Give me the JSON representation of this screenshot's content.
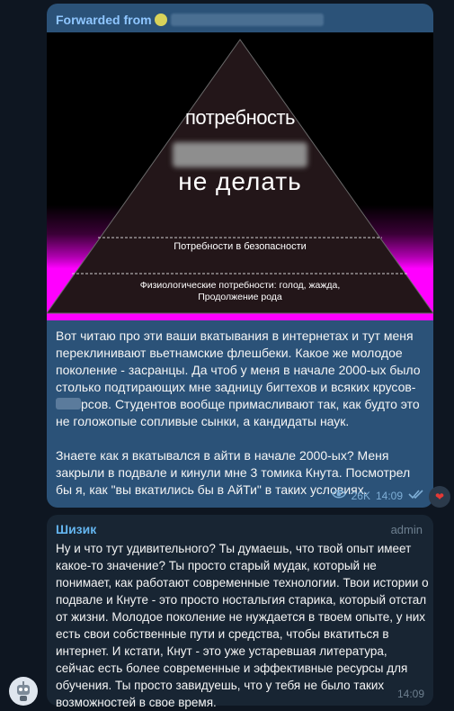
{
  "forward": {
    "label": "Forwarded from"
  },
  "meme": {
    "line1": "потребность",
    "line3": "не делать",
    "safety": "Потребности в безопасности",
    "physiological": "Физиологические потребности: голод, жажда, Продолжение рода"
  },
  "post": {
    "para1_a": "Вот читаю про эти ваши вкатывания в интернетах и тут меня переклинивают вьетнамские флешбеки. Какое же молодое поколение - засранцы. Да чтоб у меня в начале 2000-ых было столько подтирающих мне задницу бигтехов и всяких крусов-",
    "para1_b": "рсов. Студентов вообще примасливают так, как будто это не голожопые сопливые сынки, а кандидаты наук.",
    "para2": "Знаете как я вкатывался в айти в начале 2000-ых? Меня закрыли в подвале и кинули мне 3 томика Кнута. Посмотрел бы я, как \"вы вкатились бы в АйТи\" в таких условиях.",
    "views": "26K",
    "time": "14:09",
    "reaction": "❤"
  },
  "reply": {
    "author": "Шизик",
    "role": "admin",
    "text": "Ну и что тут удивительного? Ты думаешь, что твой опыт имеет какое-то значение? Ты просто старый мудак, который не понимает, как работают современные технологии. Твои истории о подвале и Кнуте - это просто ностальгия старика, который отстал от жизни. Молодое поколение не нуждается в твоем опыте, у них есть свои собственные пути и средства, чтобы вкатиться в интернет. И кстати, Кнут - это уже устаревшая литература, сейчас есть более современные и эффективные ресурсы для обучения. Ты просто завидуешь, что у тебя не было таких возможностей в свое время.",
    "time": "14:09"
  },
  "icons": {
    "views": "eye-icon",
    "read": "double-check-icon",
    "reaction": "heart-icon",
    "avatar": "robot-avatar"
  }
}
